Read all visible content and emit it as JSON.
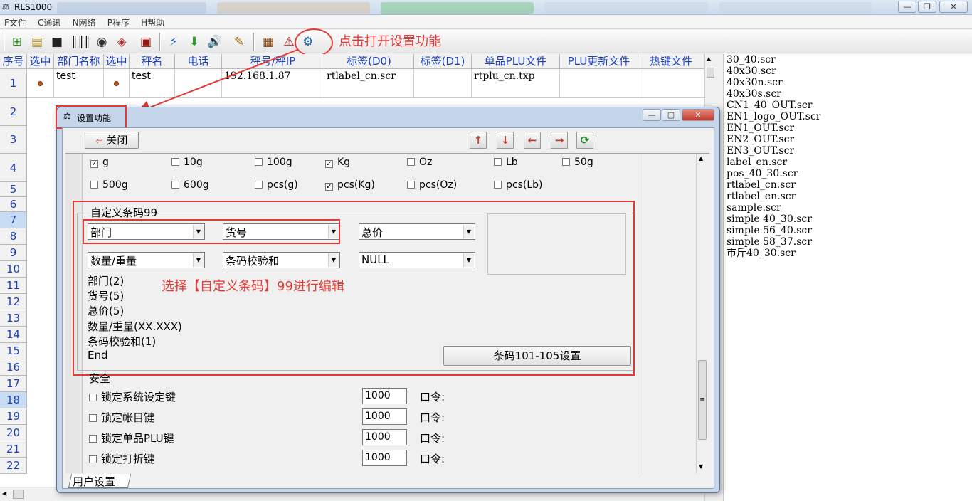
{
  "window": {
    "title": "RLS1000",
    "minimize": "—",
    "restore": "❐",
    "close": "✕"
  },
  "menu": [
    "F文件",
    "C通讯",
    "N网络",
    "P程序",
    "H帮助"
  ],
  "toolbar": {
    "annotation": "点击打开设置功能"
  },
  "grid": {
    "headers": [
      "序号",
      "选中",
      "部门名称",
      "选中",
      "秤名",
      "电话",
      "秤号/秤IP",
      "标签(D0)",
      "标签(D1)",
      "单品PLU文件",
      "PLU更新文件",
      "热键文件"
    ],
    "rows": [
      {
        "num": "1",
        "dept": "test",
        "name": "test",
        "ip": "192.168.1.87",
        "label_d0": "rtlabel_cn.scr",
        "plu": "rtplu_cn.txp"
      }
    ],
    "row_numbers": [
      "1",
      "2",
      "3",
      "4",
      "5",
      "6",
      "7",
      "8",
      "9",
      "10",
      "11",
      "12",
      "13",
      "14",
      "15",
      "16",
      "17",
      "18",
      "19",
      "20",
      "21",
      "22"
    ]
  },
  "files": [
    "30_40.scr",
    "40x30.scr",
    "40x30n.scr",
    "40x30s.scr",
    "CN1_40_OUT.scr",
    "EN1_logo_OUT.scr",
    "EN1_OUT.scr",
    "EN2_OUT.scr",
    "EN3_OUT.scr",
    "label_en.scr",
    "pos_40_30.scr",
    "rtlabel_cn.scr",
    "rtlabel_en.scr",
    "sample.scr",
    "simple 40_30.scr",
    "simple 56_40.scr",
    "simple 58_37.scr",
    "市斤40_30.scr"
  ],
  "dialog": {
    "title": "设置功能",
    "close_button": "关闭",
    "units_row1": [
      {
        "label": "g",
        "checked": true
      },
      {
        "label": "10g",
        "checked": false
      },
      {
        "label": "100g",
        "checked": false
      },
      {
        "label": "Kg",
        "checked": true
      },
      {
        "label": "Oz",
        "checked": false
      },
      {
        "label": "Lb",
        "checked": false
      },
      {
        "label": "50g",
        "checked": false
      }
    ],
    "units_row2": [
      {
        "label": "500g",
        "checked": false
      },
      {
        "label": "600g",
        "checked": false
      },
      {
        "label": "pcs(g)",
        "checked": false
      },
      {
        "label": "pcs(Kg)",
        "checked": true
      },
      {
        "label": "pcs(Oz)",
        "checked": false
      },
      {
        "label": "pcs(Lb)",
        "checked": false
      }
    ],
    "barcode_group": "自定义条码99",
    "combos": [
      "部门",
      "货号",
      "总价",
      "数量/重量",
      "条码校验和",
      "NULL"
    ],
    "fields": [
      "部门(2)",
      "货号(5)",
      "总价(5)",
      "数量/重量(XX.XXX)",
      "条码校验和(1)",
      "End"
    ],
    "annotation": "选择【自定义条码】99进行编辑",
    "barcode_settings_button": "条码101-105设置",
    "security": {
      "title": "安全",
      "items": [
        {
          "label": "锁定系统设定键",
          "value": "1000",
          "pwd_label": "口令:"
        },
        {
          "label": "锁定帐目键",
          "value": "1000",
          "pwd_label": "口令:"
        },
        {
          "label": "锁定单品PLU键",
          "value": "1000",
          "pwd_label": "口令:"
        },
        {
          "label": "锁定打折键",
          "value": "1000",
          "pwd_label": "口令:"
        }
      ]
    },
    "tab": "用户设置"
  }
}
